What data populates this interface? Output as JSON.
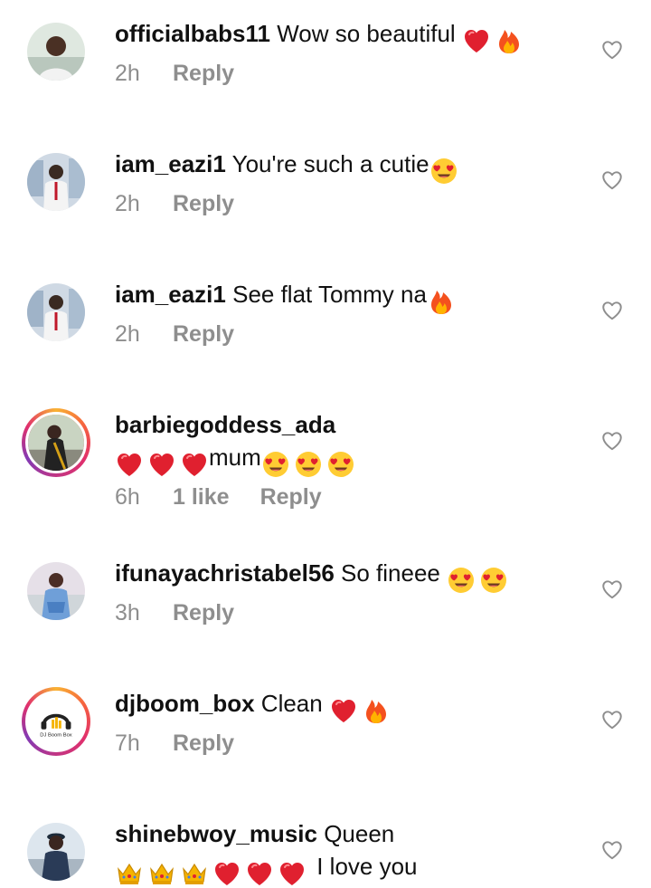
{
  "comments": [
    {
      "username": "officialbabs11",
      "text": " Wow so beautiful ",
      "emoji_after": [
        "red-heart",
        "fire"
      ],
      "time": "2h",
      "likes": "",
      "reply_label": "Reply",
      "avatar_icon": "user-avatar-icon"
    },
    {
      "username": "iam_eazi1",
      "text": " You're such a cutie",
      "emoji_after": [
        "heart-eyes"
      ],
      "time": "2h",
      "likes": "",
      "reply_label": "Reply",
      "avatar_icon": "user-avatar-icon"
    },
    {
      "username": "iam_eazi1",
      "text": " See flat Tommy na",
      "emoji_after": [
        "fire"
      ],
      "time": "2h",
      "likes": "",
      "reply_label": "Reply",
      "avatar_icon": "user-avatar-icon"
    },
    {
      "username": "barbiegoddess_ada",
      "text_line2": "mum",
      "emoji_before": [
        "red-heart",
        "red-heart",
        "red-heart"
      ],
      "emoji_after": [
        "heart-eyes",
        "heart-eyes",
        "heart-eyes"
      ],
      "time": "6h",
      "likes": "1 like",
      "reply_label": "Reply",
      "avatar_icon": "story-ring-avatar-icon"
    },
    {
      "username": "ifunayachristabel56",
      "text": " So fineee ",
      "emoji_after": [
        "heart-eyes",
        "heart-eyes"
      ],
      "time": "3h",
      "likes": "",
      "reply_label": "Reply",
      "avatar_icon": "user-avatar-icon"
    },
    {
      "username": "djboom_box",
      "text": " Clean ",
      "emoji_after": [
        "red-heart",
        "fire"
      ],
      "time": "7h",
      "likes": "",
      "reply_label": "Reply",
      "avatar_icon": "dj-logo-avatar-icon",
      "avatar_logo_text": "DJ Boom Box"
    },
    {
      "username": "shinebwoy_music",
      "text": " Queen",
      "emoji_line2": [
        "crown",
        "crown",
        "crown",
        "red-heart",
        "red-heart",
        "red-heart"
      ],
      "text_line2": " I love you",
      "time": "",
      "likes": "",
      "reply_label": "",
      "avatar_icon": "user-avatar-icon"
    }
  ],
  "like_icon": "heart-outline-icon",
  "colors": {
    "meta_gray": "#8e8e8e",
    "text": "#111111",
    "heart_red": "#e0202f"
  }
}
